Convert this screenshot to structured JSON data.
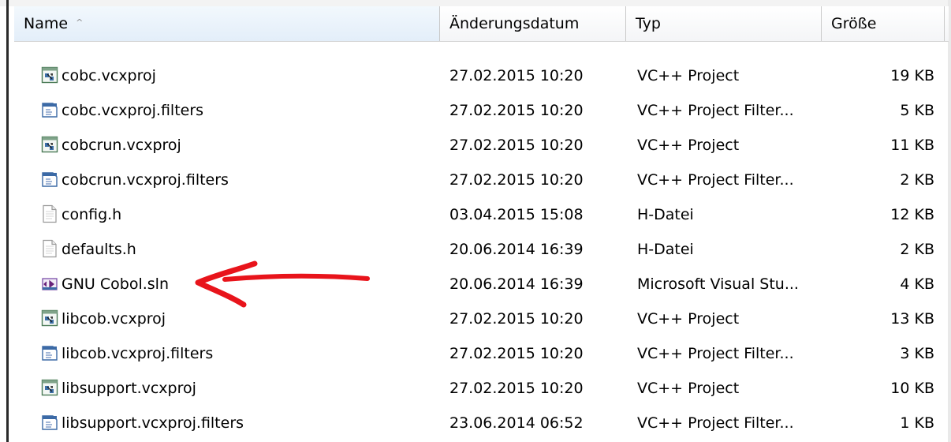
{
  "columns": {
    "name": "Name",
    "sort_indicator": "^",
    "date": "Änderungsdatum",
    "type": "Typ",
    "size": "Größe"
  },
  "files": [
    {
      "name": "cobc.vcxproj",
      "date": "27.02.2015 10:20",
      "type": "VC++ Project",
      "size": "19 KB",
      "icon": "vcxproj-icon"
    },
    {
      "name": "cobc.vcxproj.filters",
      "date": "27.02.2015 10:20",
      "type": "VC++ Project Filter...",
      "size": "5 KB",
      "icon": "filters-icon"
    },
    {
      "name": "cobcrun.vcxproj",
      "date": "27.02.2015 10:20",
      "type": "VC++ Project",
      "size": "11 KB",
      "icon": "vcxproj-icon"
    },
    {
      "name": "cobcrun.vcxproj.filters",
      "date": "27.02.2015 10:20",
      "type": "VC++ Project Filter...",
      "size": "2 KB",
      "icon": "filters-icon"
    },
    {
      "name": "config.h",
      "date": "03.04.2015 15:08",
      "type": "H-Datei",
      "size": "12 KB",
      "icon": "header-file-icon"
    },
    {
      "name": "defaults.h",
      "date": "20.06.2014 16:39",
      "type": "H-Datei",
      "size": "2 KB",
      "icon": "header-file-icon"
    },
    {
      "name": "GNU Cobol.sln",
      "date": "20.06.2014 16:39",
      "type": "Microsoft Visual Stu...",
      "size": "4 KB",
      "icon": "visual-studio-solution-icon"
    },
    {
      "name": "libcob.vcxproj",
      "date": "27.02.2015 10:20",
      "type": "VC++ Project",
      "size": "13 KB",
      "icon": "vcxproj-icon"
    },
    {
      "name": "libcob.vcxproj.filters",
      "date": "27.02.2015 10:20",
      "type": "VC++ Project Filter...",
      "size": "3 KB",
      "icon": "filters-icon"
    },
    {
      "name": "libsupport.vcxproj",
      "date": "27.02.2015 10:20",
      "type": "VC++ Project",
      "size": "10 KB",
      "icon": "vcxproj-icon"
    },
    {
      "name": "libsupport.vcxproj.filters",
      "date": "23.06.2014 06:52",
      "type": "VC++ Project Filter...",
      "size": "1 KB",
      "icon": "filters-icon"
    }
  ],
  "annotation": {
    "color": "#e8141b"
  }
}
